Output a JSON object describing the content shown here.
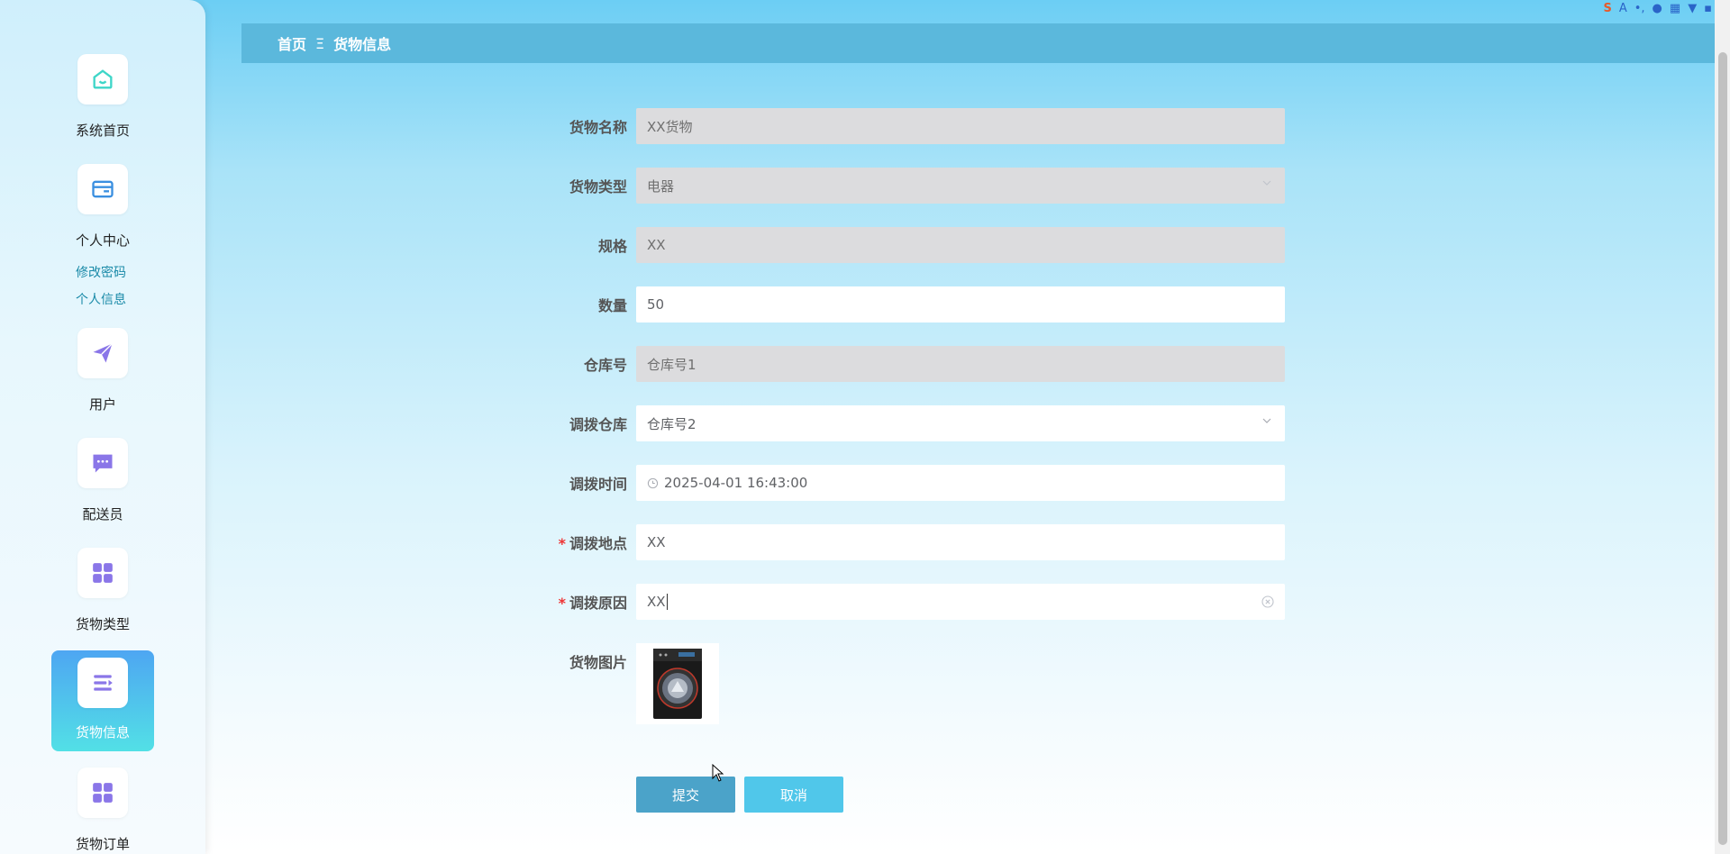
{
  "sidebar": {
    "items": [
      {
        "label": "系统首页",
        "icon": "home-icon"
      },
      {
        "label": "个人中心",
        "icon": "wallet-icon"
      },
      {
        "label": "用户",
        "icon": "paper-plane-icon"
      },
      {
        "label": "配送员",
        "icon": "chat-icon"
      },
      {
        "label": "货物类型",
        "icon": "grid-icon"
      },
      {
        "label": "货物信息",
        "icon": "list-icon"
      },
      {
        "label": "货物订单",
        "icon": "grid-icon"
      }
    ],
    "sub_links": [
      "修改密码",
      "个人信息"
    ]
  },
  "breadcrumb": {
    "home": "首页",
    "separator": "Ξ",
    "current": "货物信息"
  },
  "form": {
    "name": {
      "label": "货物名称",
      "value": "XX货物"
    },
    "type": {
      "label": "货物类型",
      "value": "电器"
    },
    "spec": {
      "label": "规格",
      "value": "XX"
    },
    "quantity": {
      "label": "数量",
      "value": "50"
    },
    "warehouse": {
      "label": "仓库号",
      "value": "仓库号1"
    },
    "transfer_warehouse": {
      "label": "调拨仓库",
      "value": "仓库号2"
    },
    "transfer_time": {
      "label": "调拨时间",
      "value": "2025-04-01 16:43:00"
    },
    "transfer_place": {
      "label": "调拨地点",
      "value": "XX",
      "required": "*"
    },
    "transfer_reason": {
      "label": "调拨原因",
      "value": "XX",
      "required": "*"
    },
    "image": {
      "label": "货物图片"
    }
  },
  "buttons": {
    "submit": "提交",
    "cancel": "取消"
  },
  "colors": {
    "breadcrumb_bg": "#5bb8dc",
    "active_nav_start": "#4ea6f2",
    "active_nav_end": "#52e0e6",
    "submit": "#4ba3c9",
    "cancel": "#50c7ea"
  }
}
